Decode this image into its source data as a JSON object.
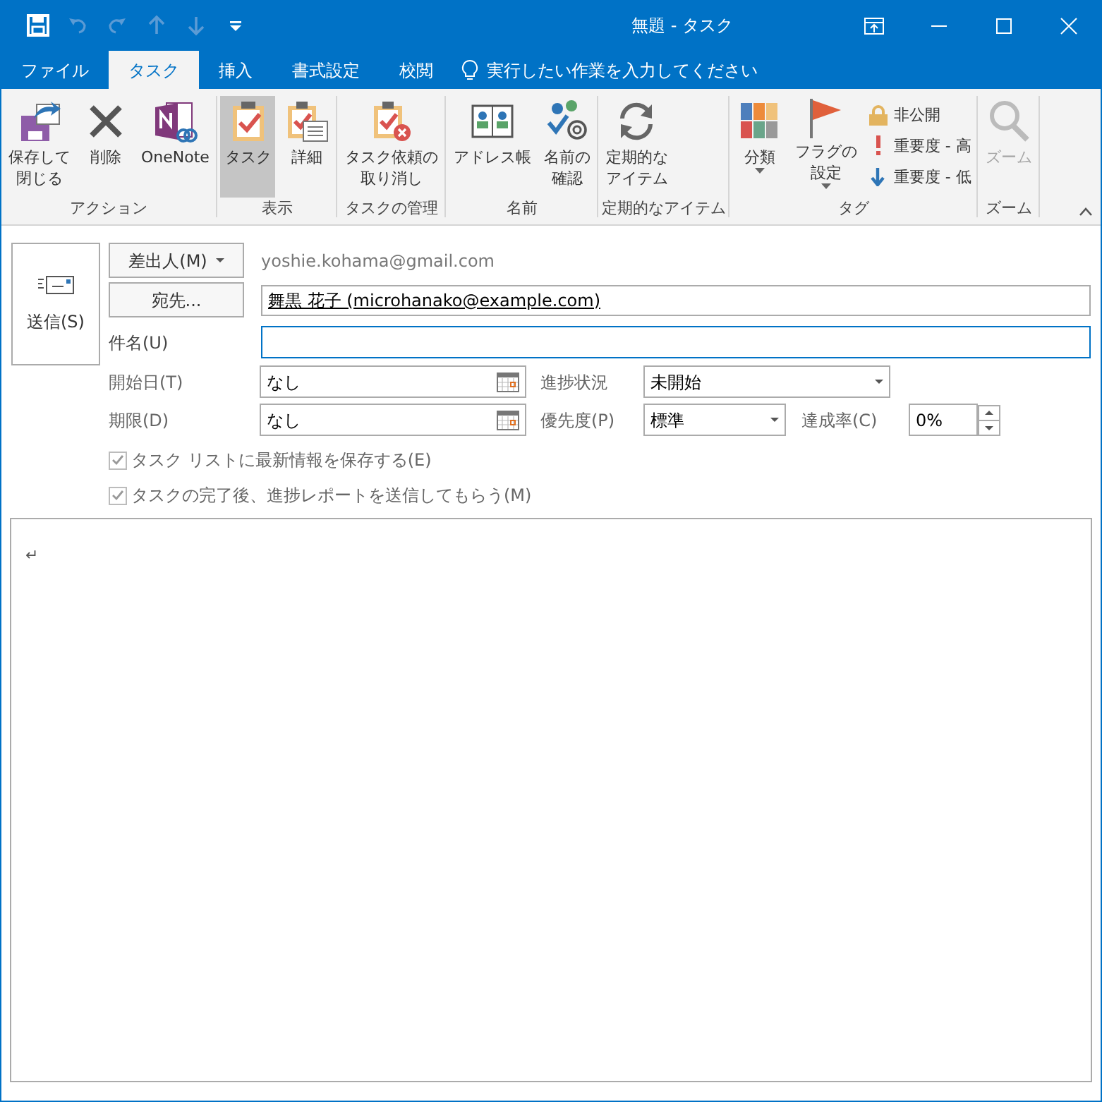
{
  "window": {
    "title": "無題 - タスク"
  },
  "quick_access": [
    {
      "kind": "save",
      "disabled": false
    },
    {
      "kind": "undo",
      "disabled": true
    },
    {
      "kind": "redo",
      "disabled": true
    },
    {
      "kind": "up",
      "disabled": true
    },
    {
      "kind": "down",
      "disabled": true
    },
    {
      "kind": "customize",
      "disabled": false
    }
  ],
  "tabs": [
    {
      "label": "ファイル",
      "selected": false
    },
    {
      "label": "タスク",
      "selected": true
    },
    {
      "label": "挿入",
      "selected": false
    },
    {
      "label": "書式設定",
      "selected": false
    },
    {
      "label": "校閲",
      "selected": false
    }
  ],
  "tell_me": "実行したい作業を入力してください",
  "ribbon_groups": [
    {
      "label": "アクション",
      "buttons": [
        {
          "kind": "large",
          "label_lines": [
            "保存して",
            "閉じる"
          ],
          "selected": false,
          "disabled": false
        },
        {
          "kind": "large",
          "label_lines": [
            "削除"
          ],
          "selected": false,
          "disabled": false
        },
        {
          "kind": "large",
          "label_lines": [
            "OneNote"
          ],
          "selected": false,
          "disabled": false
        }
      ]
    },
    {
      "label": "表示",
      "buttons": [
        {
          "kind": "large",
          "label_lines": [
            "タスク"
          ],
          "selected": true,
          "disabled": false
        },
        {
          "kind": "large",
          "label_lines": [
            "詳細"
          ],
          "selected": false,
          "disabled": false
        }
      ]
    },
    {
      "label": "タスクの管理",
      "buttons": [
        {
          "kind": "large",
          "label_lines": [
            "タスク依頼の",
            "取り消し"
          ],
          "selected": false,
          "disabled": false
        }
      ]
    },
    {
      "label": "名前",
      "buttons": [
        {
          "kind": "large",
          "label_lines": [
            "アドレス帳"
          ],
          "selected": false,
          "disabled": false
        },
        {
          "kind": "large",
          "label_lines": [
            "名前の",
            "確認"
          ],
          "selected": false,
          "disabled": false
        }
      ]
    },
    {
      "label": "定期的なアイテム",
      "buttons": [
        {
          "kind": "large",
          "label_lines": [
            "定期的な",
            "アイテム"
          ],
          "selected": false,
          "disabled": false
        }
      ]
    },
    {
      "label": "タグ",
      "buttons": [
        {
          "kind": "large-dropdown",
          "label_lines": [
            "分類"
          ],
          "selected": false,
          "disabled": false
        },
        {
          "kind": "large-dropdown",
          "label_lines": [
            "フラグの",
            "設定"
          ],
          "selected": false,
          "disabled": false
        },
        {
          "kind": "small",
          "label_lines": [
            "非公開"
          ],
          "selected": false,
          "disabled": false
        },
        {
          "kind": "small",
          "label_lines": [
            "重要度 - 高"
          ],
          "selected": false,
          "disabled": false
        },
        {
          "kind": "small",
          "label_lines": [
            "重要度 - 低"
          ],
          "selected": false,
          "disabled": false
        }
      ]
    },
    {
      "label": "ズーム",
      "buttons": [
        {
          "kind": "large",
          "label_lines": [
            "ズーム"
          ],
          "selected": false,
          "disabled": true
        }
      ]
    }
  ],
  "form": {
    "send_button": "送信(S)",
    "from_button": "差出人(M)",
    "from_value": "yoshie.kohama@gmail.com",
    "to_button": "宛先...",
    "to_value": "舞黒 花子 (microhanako@example.com)",
    "subject_label": "件名(U)",
    "start_label": "開始日(T)",
    "start_value": "なし",
    "due_label": "期限(D)",
    "due_value": "なし",
    "status_label": "進捗状況",
    "status_value": "未開始",
    "priority_label": "優先度(P)",
    "priority_value": "標準",
    "percent_label": "達成率(C)",
    "percent_value": "0%",
    "checkboxes": [
      {
        "label": "タスク リストに最新情報を保存する(E)",
        "checked": true,
        "disabled": true
      },
      {
        "label": "タスクの完了後、進捗レポートを送信してもらう(M)",
        "checked": true,
        "disabled": true
      }
    ]
  },
  "body": {
    "text": "↵"
  }
}
